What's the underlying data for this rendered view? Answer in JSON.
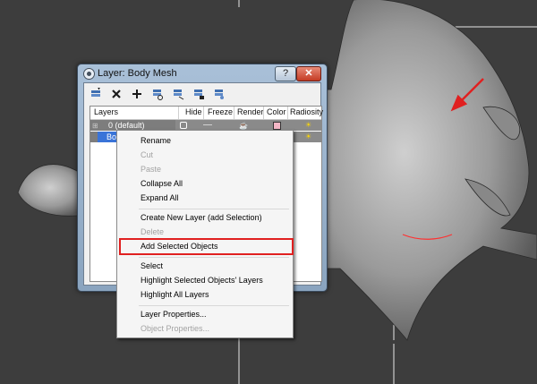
{
  "window": {
    "title": "Layer: Body Mesh",
    "help_label": "?",
    "close_label": "✕"
  },
  "toolbar": {
    "buttons": [
      "new-layer-icon",
      "delete-icon",
      "add-icon",
      "select-objects-icon",
      "highlight-layer-icon",
      "hide-all-icon",
      "freeze-all-icon"
    ]
  },
  "columns": [
    "Layers",
    "Hide",
    "Freeze",
    "Render",
    "Color",
    "Radiosity"
  ],
  "layers": [
    {
      "name": "0 (default)"
    },
    {
      "name": "Bo"
    }
  ],
  "colors": {
    "layer0_color": "#f4b6c6",
    "accent_red": "#e02020",
    "selection_blue": "#3a74d8"
  },
  "context_menu": {
    "items": [
      {
        "label": "Rename",
        "enabled": true
      },
      {
        "label": "Cut",
        "enabled": false
      },
      {
        "label": "Paste",
        "enabled": false
      },
      {
        "label": "Collapse All",
        "enabled": true
      },
      {
        "label": "Expand All",
        "enabled": true
      },
      {
        "label": "Create New Layer (add Selection)",
        "enabled": true
      },
      {
        "label": "Delete",
        "enabled": false
      },
      {
        "label": "Add Selected Objects",
        "enabled": true,
        "highlighted": true
      },
      {
        "label": "Select",
        "enabled": true
      },
      {
        "label": "Highlight Selected Objects' Layers",
        "enabled": true
      },
      {
        "label": "Highlight All Layers",
        "enabled": true
      },
      {
        "label": "Layer Properties...",
        "enabled": true
      },
      {
        "label": "Object Properties...",
        "enabled": false
      }
    ]
  }
}
